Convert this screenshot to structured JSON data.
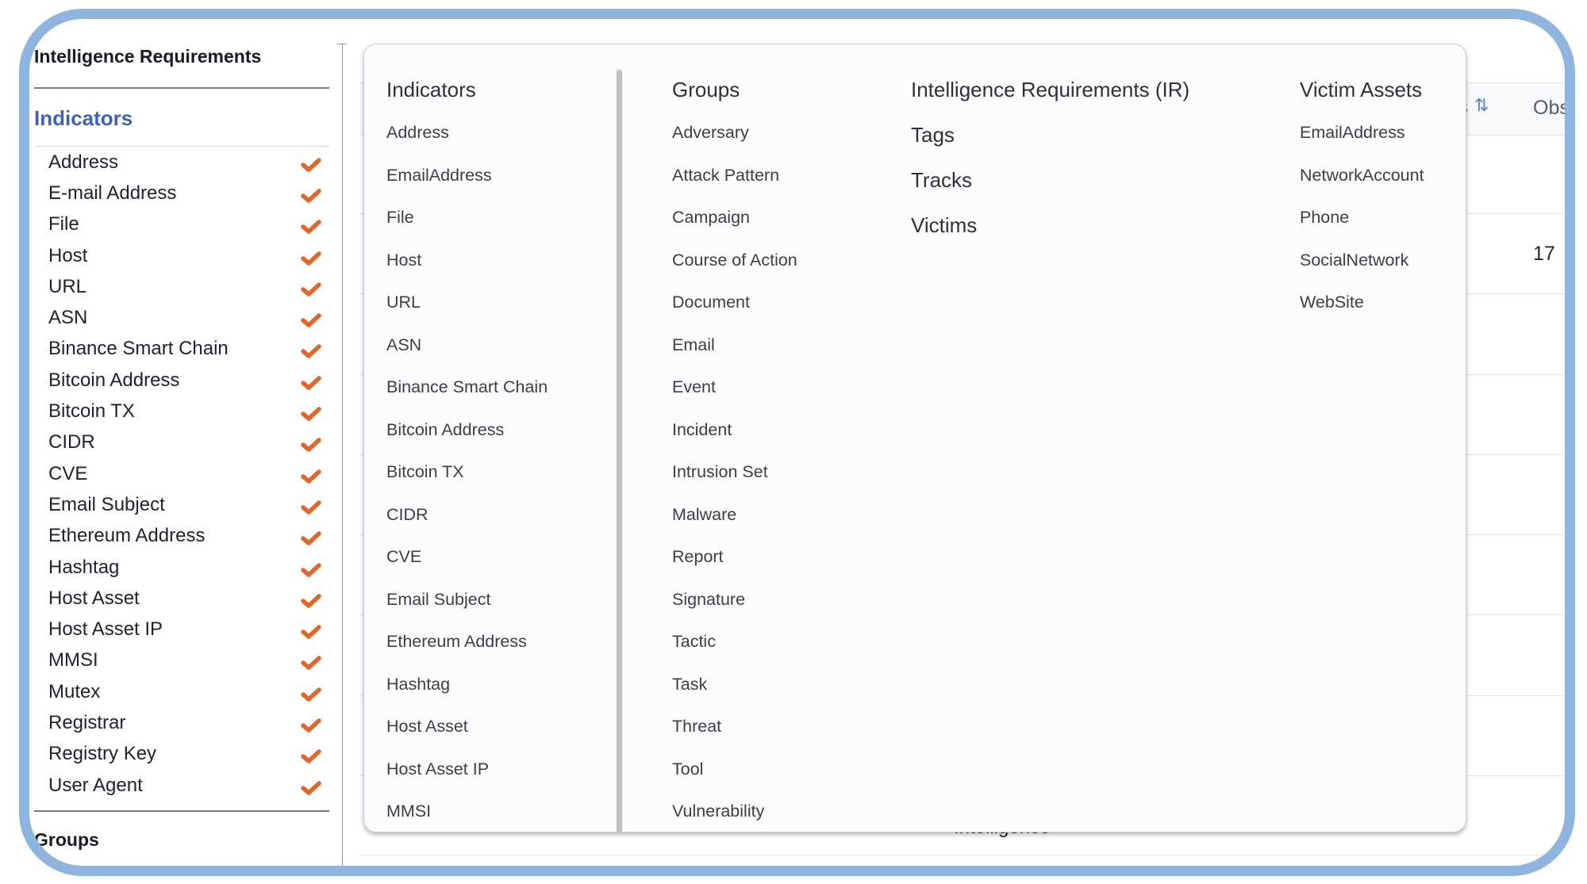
{
  "sidebar": {
    "title": "Intelligence Requirements",
    "section_label": "Indicators",
    "items": [
      {
        "label": "Address",
        "checked": true
      },
      {
        "label": "E-mail Address",
        "checked": true
      },
      {
        "label": "File",
        "checked": true
      },
      {
        "label": "Host",
        "checked": true
      },
      {
        "label": "URL",
        "checked": true
      },
      {
        "label": "ASN",
        "checked": true
      },
      {
        "label": "Binance Smart Chain",
        "checked": true
      },
      {
        "label": "Bitcoin Address",
        "checked": true
      },
      {
        "label": "Bitcoin TX",
        "checked": true
      },
      {
        "label": "CIDR",
        "checked": true
      },
      {
        "label": "CVE",
        "checked": true
      },
      {
        "label": "Email Subject",
        "checked": true
      },
      {
        "label": "Ethereum Address",
        "checked": true
      },
      {
        "label": "Hashtag",
        "checked": true
      },
      {
        "label": "Host Asset",
        "checked": true
      },
      {
        "label": "Host Asset IP",
        "checked": true
      },
      {
        "label": "MMSI",
        "checked": true
      },
      {
        "label": "Mutex",
        "checked": true
      },
      {
        "label": "Registrar",
        "checked": true
      },
      {
        "label": "Registry Key",
        "checked": true
      },
      {
        "label": "User Agent",
        "checked": true
      }
    ],
    "next_section_label": "Groups",
    "check_color": "#E0672B",
    "section_color": "#3E63B5"
  },
  "table": {
    "header_partial": "s",
    "header_obs": "Obs",
    "sort_icon": "sort-arrows-icon",
    "row_value": "17",
    "partial_text_behind": "Intelligence"
  },
  "popover": {
    "indicators": {
      "title": "Indicators",
      "items": [
        "Address",
        "EmailAddress",
        "File",
        "Host",
        "URL",
        "ASN",
        "Binance Smart Chain",
        "Bitcoin Address",
        "Bitcoin TX",
        "CIDR",
        "CVE",
        "Email Subject",
        "Ethereum Address",
        "Hashtag",
        "Host Asset",
        "Host Asset IP",
        "MMSI"
      ]
    },
    "groups": {
      "title": "Groups",
      "items": [
        "Adversary",
        "Attack Pattern",
        "Campaign",
        "Course of Action",
        "Document",
        "Email",
        "Event",
        "Incident",
        "Intrusion Set",
        "Malware",
        "Report",
        "Signature",
        "Tactic",
        "Task",
        "Threat",
        "Tool",
        "Vulnerability"
      ]
    },
    "other_sections": [
      "Intelligence Requirements (IR)",
      "Tags",
      "Tracks",
      "Victims"
    ],
    "victim_assets": {
      "title": "Victim Assets",
      "items": [
        "EmailAddress",
        "NetworkAccount",
        "Phone",
        "SocialNetwork",
        "WebSite"
      ]
    }
  },
  "frame_color": "#8FB4E0"
}
